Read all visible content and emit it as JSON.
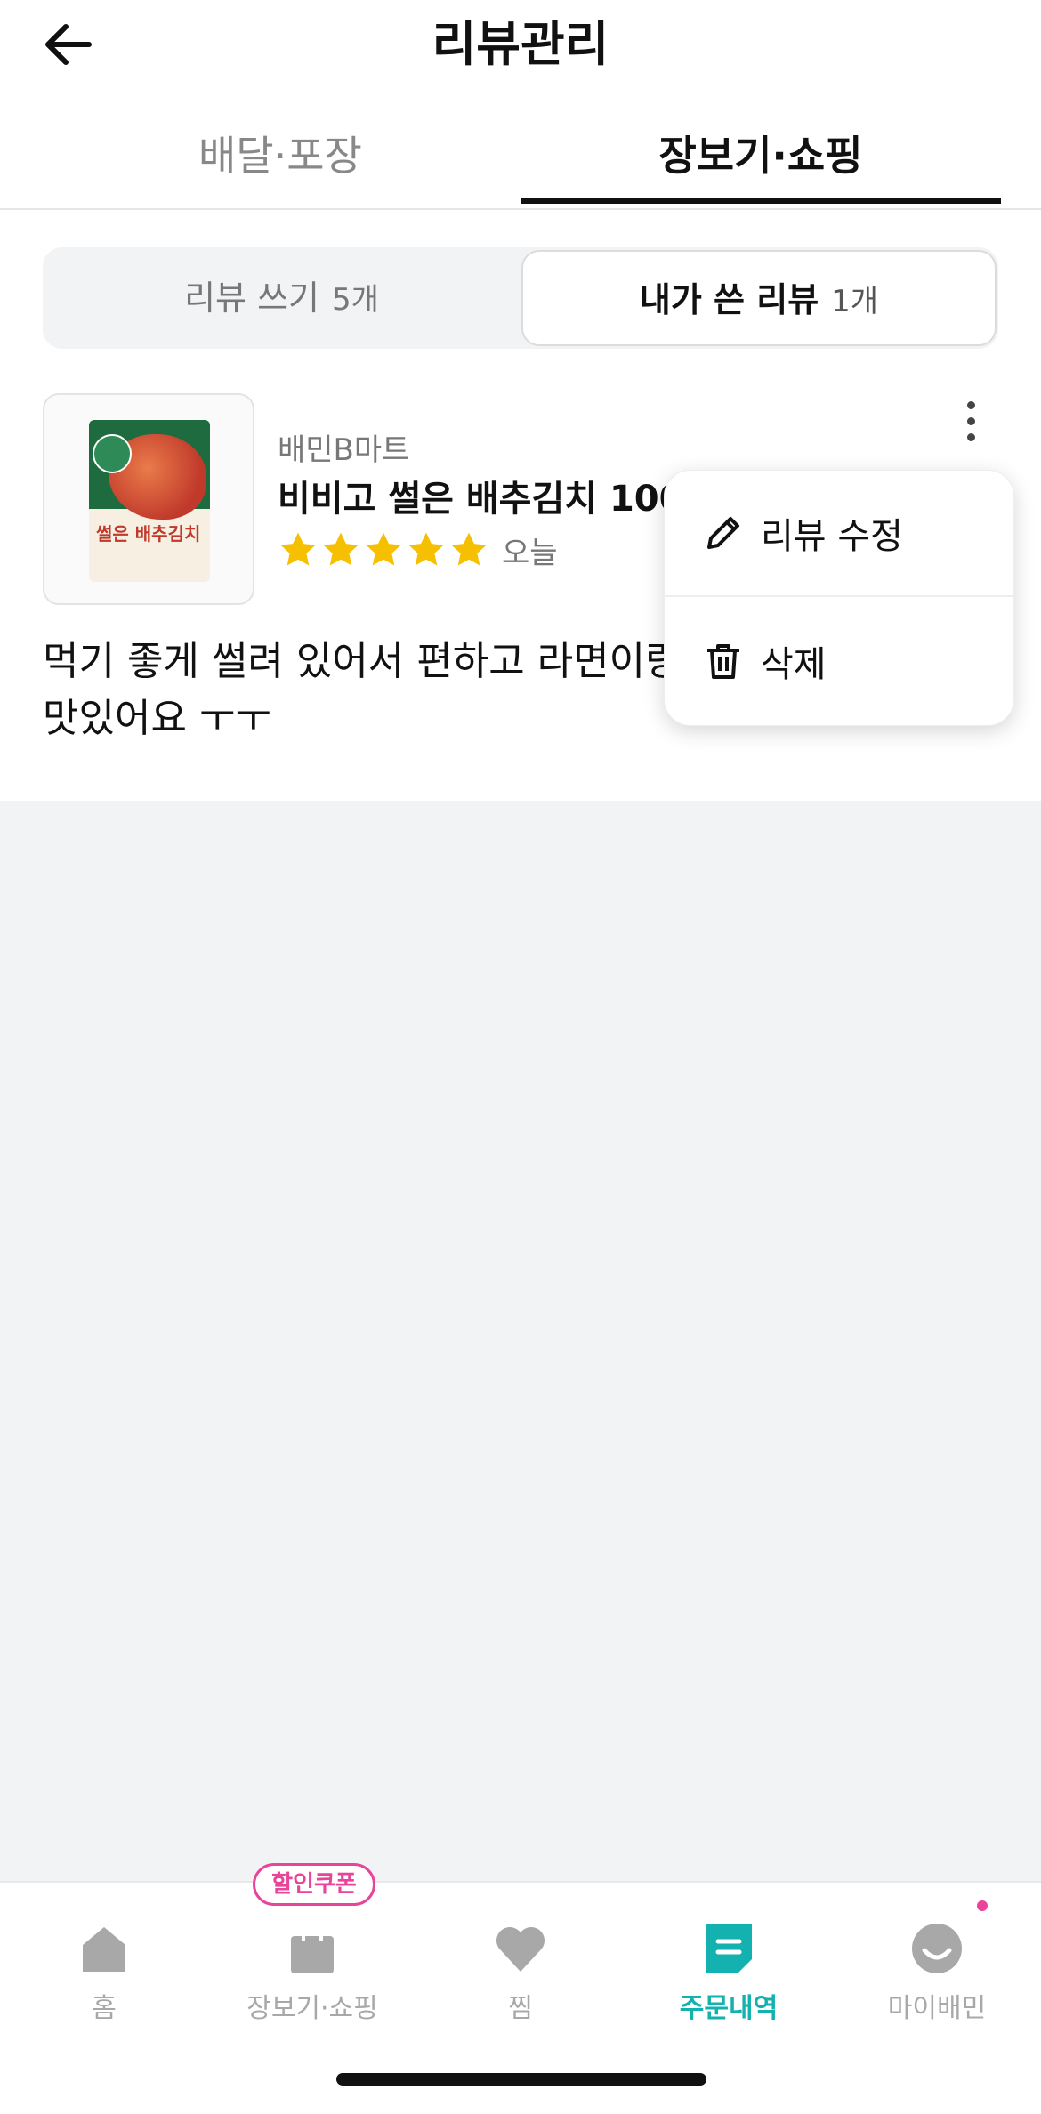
{
  "header": {
    "title": "리뷰관리",
    "back_icon": "arrow-left-icon"
  },
  "tabs": [
    {
      "label": "배달·포장",
      "active": false
    },
    {
      "label": "장보기·쇼핑",
      "active": true
    }
  ],
  "segment": {
    "write": {
      "label": "리뷰 쓰기",
      "count": "5개"
    },
    "mine": {
      "label": "내가 쓴 리뷰",
      "count": "1개"
    }
  },
  "review": {
    "store": "배민B마트",
    "product": "비비고 썰은 배추김치 100",
    "rating": 5,
    "date": "오늘",
    "text_line1": "먹기 좋게 썰려 있어서 편하고 라면이랑",
    "text_line2": "맛있어요 ㅜㅜ",
    "thumbnail_label": "썰은 배추김치"
  },
  "menu": {
    "edit": "리뷰 수정",
    "delete": "삭제"
  },
  "bottom_nav": {
    "items": [
      {
        "label": "홈",
        "icon": "home-icon"
      },
      {
        "label": "장보기·쇼핑",
        "icon": "shopping-bag-icon"
      },
      {
        "label": "찜",
        "icon": "heart-icon"
      },
      {
        "label": "주문내역",
        "icon": "order-list-icon",
        "active": true
      },
      {
        "label": "마이배민",
        "icon": "profile-face-icon"
      }
    ],
    "coupon_badge": "할인쿠폰"
  },
  "colors": {
    "accent": "#13b2b0",
    "star": "#f6c000",
    "badge": "#e8449a"
  }
}
